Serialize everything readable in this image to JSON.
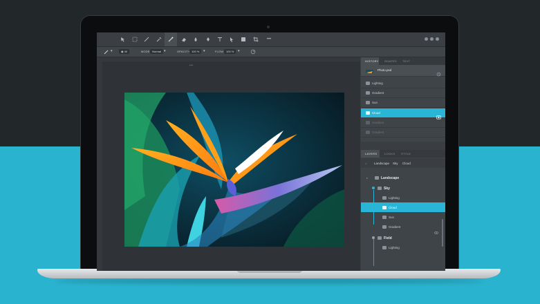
{
  "toolbar": {
    "tools": [
      "move-icon",
      "marquee-icon",
      "lasso-icon",
      "eyedropper-icon",
      "brush-icon",
      "eraser-icon",
      "fill-icon",
      "pen-icon",
      "text-icon",
      "pointer-icon",
      "shape-icon",
      "crop-icon",
      "more-icon"
    ],
    "active_tool": "brush-icon",
    "more_label": "•••"
  },
  "options": {
    "size_value": "40",
    "mode_label": "MODE",
    "mode_value": "Normal",
    "opacity_label": "OPACITY",
    "opacity_value": "100 %",
    "flow_label": "FLOW",
    "flow_value": "100 %"
  },
  "canvas": {
    "grip": "•••"
  },
  "history_panel": {
    "tabs": [
      "HISTORY",
      "SHAPES",
      "TEXT"
    ],
    "active_tab": "HISTORY",
    "file_name": "Photo.psd",
    "items": [
      {
        "label": "Lighting",
        "state": "normal"
      },
      {
        "label": "Gradient",
        "state": "normal"
      },
      {
        "label": "Sun",
        "state": "normal"
      },
      {
        "label": "Cloud",
        "state": "selected"
      },
      {
        "label": "Gradient",
        "state": "dim"
      },
      {
        "label": "Gradient",
        "state": "dim"
      }
    ]
  },
  "layers_panel": {
    "tabs": [
      "LAYERS",
      "LOOKS",
      "STYLE"
    ],
    "active_tab": "LAYERS",
    "breadcrumb": [
      "Landscape",
      "Sky",
      "Cloud"
    ],
    "rows": [
      {
        "label": "Landscape",
        "level": 0,
        "bold": true
      },
      {
        "label": "Sky",
        "level": 1,
        "bold": true
      },
      {
        "label": "Lighting",
        "level": 2,
        "bold": false
      },
      {
        "label": "Cloud",
        "level": 2,
        "bold": false,
        "selected": true
      },
      {
        "label": "Sun",
        "level": 2,
        "bold": false
      },
      {
        "label": "Gradient",
        "level": 2,
        "bold": false
      },
      {
        "label": "Field",
        "level": 1,
        "bold": true
      },
      {
        "label": "Lighting",
        "level": 2,
        "bold": false
      }
    ]
  },
  "colors": {
    "accent": "#29b6d6",
    "background_top": "#22272a",
    "background_bottom": "#2ab3cf"
  }
}
